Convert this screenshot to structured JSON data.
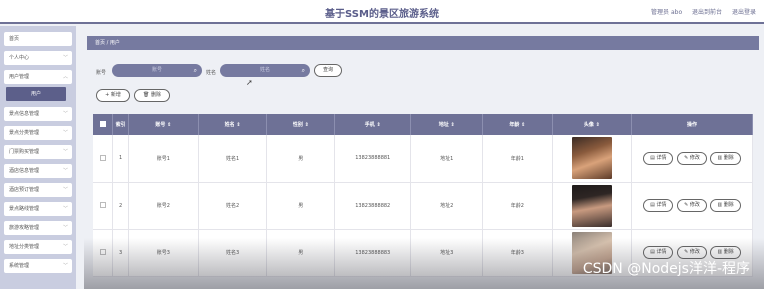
{
  "header": {
    "title": "基于SSM的景区旅游系统",
    "user_label": "管理员 abo",
    "to_front": "退出到前台",
    "logout": "退出登录"
  },
  "sidebar": {
    "items": [
      {
        "label": "首页"
      },
      {
        "label": "个人中心"
      },
      {
        "label": "用户管理"
      },
      {
        "label": "景点信息管理"
      },
      {
        "label": "景点分类管理"
      },
      {
        "label": "门票购买管理"
      },
      {
        "label": "酒店信息管理"
      },
      {
        "label": "酒店预订管理"
      },
      {
        "label": "景点路线管理"
      },
      {
        "label": "旅游攻略管理"
      },
      {
        "label": "地址分类管理"
      },
      {
        "label": "系统管理"
      }
    ],
    "active_sub": "用户"
  },
  "breadcrumb": {
    "home": "首页",
    "sep": "/",
    "current": "用户"
  },
  "search": {
    "account_label": "账号",
    "account_placeholder": "账号",
    "name_label": "姓名",
    "name_placeholder": "姓名",
    "query_button": "查询"
  },
  "actions": {
    "add": "+ 新增",
    "delete": "删除"
  },
  "table": {
    "headers": [
      "索引",
      "账号 ⇕",
      "姓名 ⇕",
      "性别 ⇕",
      "手机 ⇕",
      "地址 ⇕",
      "年龄 ⇕",
      "头像 ⇕",
      "操作"
    ],
    "rows": [
      {
        "index": "1",
        "account": "账号1",
        "name": "姓名1",
        "gender": "男",
        "phone": "13823888881",
        "address": "地址1",
        "age": "年龄1"
      },
      {
        "index": "2",
        "account": "账号2",
        "name": "姓名2",
        "gender": "男",
        "phone": "13823888882",
        "address": "地址2",
        "age": "年龄2"
      },
      {
        "index": "3",
        "account": "账号3",
        "name": "姓名3",
        "gender": "男",
        "phone": "13823888883",
        "address": "地址3",
        "age": "年龄3"
      }
    ],
    "ops": {
      "detail": "详情",
      "edit": "修改",
      "delete": "删除"
    }
  },
  "watermark": "CSDN @Nodejs洋洋-程序"
}
